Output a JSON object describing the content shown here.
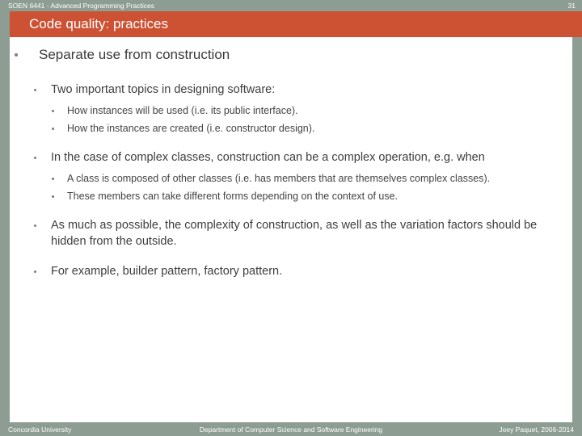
{
  "theme": {
    "frame_color": "#8d9d93",
    "accent_color": "#cd5133",
    "page_color": "#ffffff",
    "body_text_color": "#3d3d3d",
    "bullet_color": "#7f7f7f"
  },
  "header": {
    "course": "SOEN 6441 - Advanced Programming Practices",
    "page_number": "31"
  },
  "title": {
    "text": "Code quality: practices"
  },
  "body": {
    "bullets": [
      {
        "level": 1,
        "text": "Separate use from construction"
      },
      {
        "level": 2,
        "text": "Two important topics in designing software:"
      },
      {
        "level": 3,
        "text": "How instances will be used (i.e. its public interface)."
      },
      {
        "level": 3,
        "text": "How the instances are created (i.e. constructor design)."
      },
      {
        "level": 2,
        "text": "In the case of complex classes, construction can be a complex operation, e.g. when"
      },
      {
        "level": 3,
        "text": "A class is composed of other classes (i.e. has members that are themselves complex classes)."
      },
      {
        "level": 3,
        "text": "These members can take different forms depending on the context of use."
      },
      {
        "level": 2,
        "text": "As much as possible, the complexity of construction, as well as the variation factors should be hidden from the outside."
      },
      {
        "level": 2,
        "text": "For example, builder pattern, factory pattern."
      }
    ]
  },
  "footer": {
    "left": "Concordia University",
    "center": "Department of Computer Science and Software Engineering",
    "right": "Joey Paquet, 2006-2014"
  }
}
